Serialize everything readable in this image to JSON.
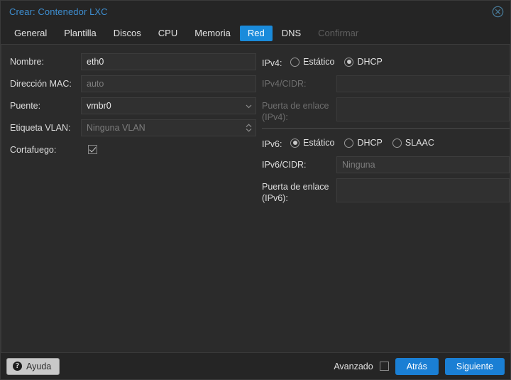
{
  "window": {
    "title": "Crear: Contenedor LXC",
    "close_icon": "close-circle-icon"
  },
  "tabs": [
    {
      "label": "General",
      "state": "normal"
    },
    {
      "label": "Plantilla",
      "state": "normal"
    },
    {
      "label": "Discos",
      "state": "normal"
    },
    {
      "label": "CPU",
      "state": "normal"
    },
    {
      "label": "Memoria",
      "state": "normal"
    },
    {
      "label": "Red",
      "state": "active"
    },
    {
      "label": "DNS",
      "state": "normal"
    },
    {
      "label": "Confirmar",
      "state": "disabled"
    }
  ],
  "left": {
    "name": {
      "label": "Nombre:",
      "value": "eth0"
    },
    "mac": {
      "label": "Dirección MAC:",
      "placeholder": "auto"
    },
    "bridge": {
      "label": "Puente:",
      "value": "vmbr0",
      "icon": "chevron-down-icon"
    },
    "vlan": {
      "label": "Etiqueta VLAN:",
      "placeholder": "Ninguna VLAN",
      "icon": "spinner-updown-icon"
    },
    "firewall": {
      "label": "Cortafuego:",
      "checked": true
    }
  },
  "right": {
    "ipv4": {
      "label": "IPv4:",
      "options": [
        {
          "label": "Estático",
          "selected": false
        },
        {
          "label": "DHCP",
          "selected": true
        }
      ],
      "cidr": {
        "label": "IPv4/CIDR:",
        "value": "",
        "disabled": true
      },
      "gateway": {
        "label": "Puerta de enlace (IPv4):",
        "line1": "Puerta de enlace",
        "line2": "(IPv4):",
        "value": "",
        "disabled": true
      }
    },
    "ipv6": {
      "label": "IPv6:",
      "options": [
        {
          "label": "Estático",
          "selected": true
        },
        {
          "label": "DHCP",
          "selected": false
        },
        {
          "label": "SLAAC",
          "selected": false
        }
      ],
      "cidr": {
        "label": "IPv6/CIDR:",
        "placeholder": "Ninguna"
      },
      "gateway": {
        "label": "Puerta de enlace (IPv6):",
        "line1": "Puerta de enlace",
        "line2": "(IPv6):",
        "value": ""
      }
    }
  },
  "footer": {
    "help": {
      "label": "Ayuda",
      "icon": "question-mark-icon"
    },
    "advanced": {
      "label": "Avanzado",
      "checked": false
    },
    "back": "Atrás",
    "next": "Siguiente"
  },
  "colors": {
    "accent": "#1a8bdb",
    "title": "#3e8ed0",
    "button": "#1a7fd4",
    "body_bg": "#2b2b2b",
    "chrome_bg": "#252525"
  }
}
